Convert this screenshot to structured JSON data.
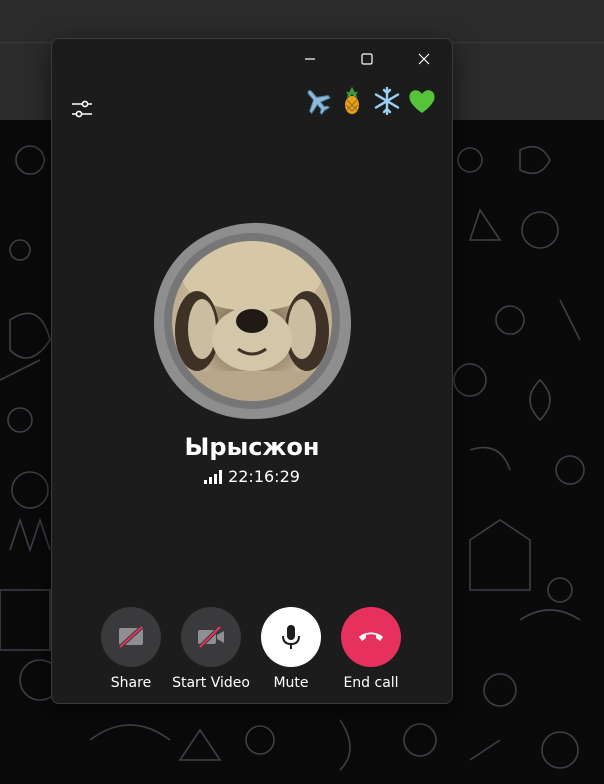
{
  "colors": {
    "window_bg": "#1c1c1c",
    "secondary_button": "#3a3a3c",
    "mute_button": "#ffffff",
    "end_call": "#e6315e",
    "crossed_line": "#e6315e"
  },
  "window": {
    "controls": [
      {
        "name": "minimize-button",
        "icon": "minimize-icon"
      },
      {
        "name": "maximize-button",
        "icon": "maximize-icon"
      },
      {
        "name": "close-button",
        "icon": "close-icon"
      }
    ]
  },
  "toolbar": {
    "settings_icon": "sliders-icon"
  },
  "emojis": [
    "✈️",
    "🍍",
    "❄️",
    "💚"
  ],
  "call": {
    "name": "Ырысжон",
    "duration": "22:16:29",
    "signal_icon": "signal-bars-icon"
  },
  "actions": [
    {
      "label": "Share",
      "icon": "screen-share-off-icon"
    },
    {
      "label": "Start Video",
      "icon": "video-off-icon"
    },
    {
      "label": "Mute",
      "icon": "microphone-icon"
    },
    {
      "label": "End call",
      "icon": "phone-hangup-icon"
    }
  ]
}
